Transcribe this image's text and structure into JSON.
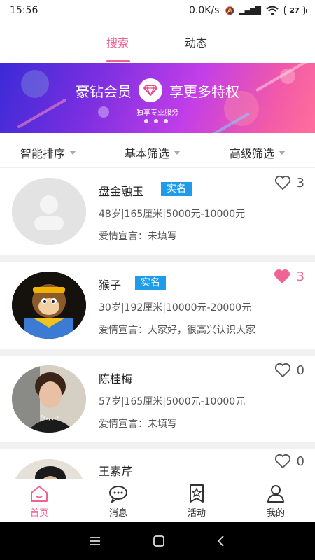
{
  "status": {
    "time": "15:56",
    "speed": "0.0K/s",
    "battery": "27"
  },
  "top_tabs": [
    {
      "label": "搜索",
      "active": true
    },
    {
      "label": "动态",
      "active": false
    }
  ],
  "banner": {
    "left_text": "豪钻会员",
    "right_text": "享更多特权",
    "subtitle": "独享专业服务",
    "pages": 3
  },
  "filters": [
    {
      "label": "智能排序"
    },
    {
      "label": "基本筛选"
    },
    {
      "label": "高级筛选"
    }
  ],
  "members": [
    {
      "name": "盘金融玉",
      "badge": "实名",
      "info": "48岁|165厘米|5000元-10000元",
      "declaration": "爱情宣言：未填写",
      "likes": "3",
      "liked": false
    },
    {
      "name": "猴子",
      "badge": "实名",
      "info": "30岁|192厘米|10000元-20000元",
      "declaration": "爱情宣言：大家好，很高兴认识大家",
      "likes": "3",
      "liked": true
    },
    {
      "name": "陈桂梅",
      "badge": "",
      "info": "57岁|165厘米|5000元-10000元",
      "declaration": "爱情宣言：未填写",
      "likes": "0",
      "liked": false
    },
    {
      "name": "王素芹",
      "badge": "",
      "info": "",
      "declaration": "",
      "likes": "0",
      "liked": false
    }
  ],
  "bottom_nav": [
    {
      "label": "首页",
      "icon": "home-icon",
      "active": true
    },
    {
      "label": "消息",
      "icon": "message-icon",
      "active": false
    },
    {
      "label": "活动",
      "icon": "activity-icon",
      "active": false
    },
    {
      "label": "我的",
      "icon": "user-icon",
      "active": false
    }
  ],
  "colors": {
    "accent": "#f06292",
    "badge": "#1e9be9"
  }
}
